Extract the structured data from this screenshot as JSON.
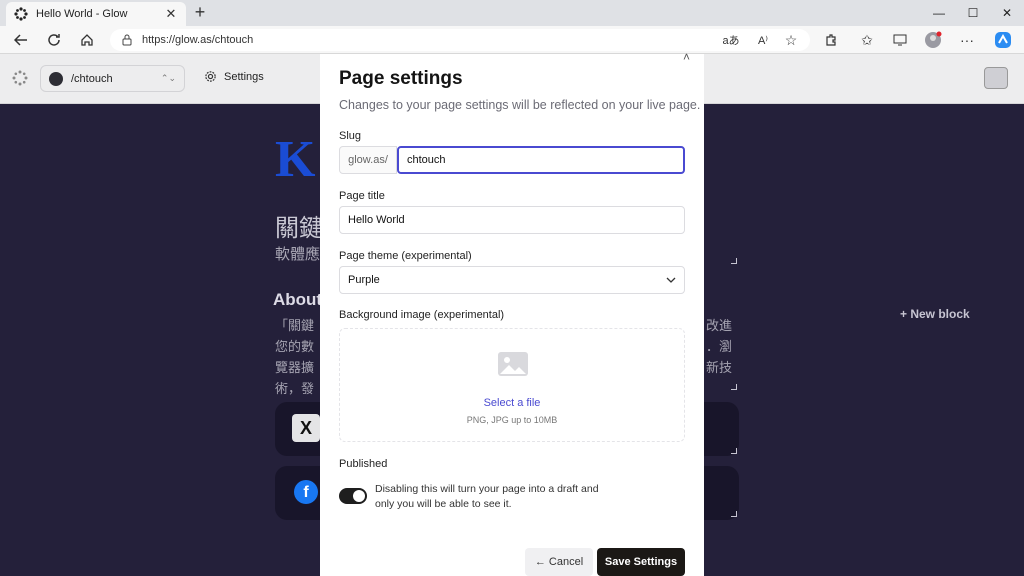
{
  "browser": {
    "tab_title": "Hello World - Glow",
    "tab_close": "✕",
    "new_tab": "+",
    "url": "https://glow.as/chtouch",
    "window_controls": {
      "minimize": "—",
      "maximize": "☐",
      "close": "✕"
    }
  },
  "appbar": {
    "page_selector": "/chtouch",
    "settings_label": "Settings"
  },
  "background_page": {
    "logo_text": "K",
    "title": "關鍵",
    "subtitle": "軟體應",
    "about_heading": "About",
    "about_lines": [
      "「關鍵",
      "您的數",
      "覽器擴",
      "術，發"
    ],
    "about_right_lines": [
      "改進",
      "．瀏",
      "新技"
    ],
    "new_block": "+ New block",
    "social_x": "X",
    "social_fb": "f"
  },
  "modal": {
    "close": "˄",
    "title": "Page settings",
    "description": "Changes to your page settings will be reflected on your live page.",
    "slug": {
      "label": "Slug",
      "prefix": "glow.as/",
      "value": "chtouch"
    },
    "page_title": {
      "label": "Page title",
      "value": "Hello World"
    },
    "theme": {
      "label": "Page theme (experimental)",
      "value": "Purple"
    },
    "background_image": {
      "label": "Background image (experimental)",
      "select_file": "Select a file",
      "hint": "PNG, JPG up to 10MB"
    },
    "published": {
      "label": "Published",
      "enabled": true,
      "description": "Disabling this will turn your page into a draft and only you will be able to see it."
    },
    "cancel_label": "← Cancel",
    "save_label": "Save Settings"
  },
  "colors": {
    "accent": "#4a4ad1",
    "page_background": "#24203a",
    "save_button": "#1b1815"
  }
}
